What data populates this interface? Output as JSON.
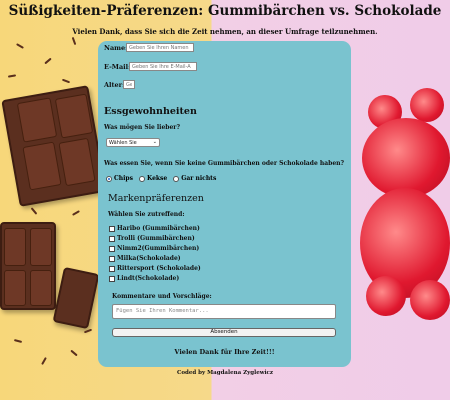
{
  "header": {
    "title": "Süßigkeiten-Präferenzen: Gummibärchen vs. Schokolade",
    "subtitle": "Vielen Dank, dass Sie sich die Zeit nehmen, an dieser Umfrage teilzunehmen."
  },
  "form": {
    "name_label": "Name:",
    "name_placeholder": "Geben Sie Ihren Namen",
    "email_label": "E-Mail:",
    "email_placeholder": "Geben Sie Ihre E-Mail-A",
    "age_label": "Alter:",
    "age_placeholder": "Ge",
    "eating_heading": "Essgewohnheiten",
    "prefer_question": "Was mögen Sie lieber?",
    "prefer_select": "Wählen Sie",
    "alt_question": "Was essen Sie, wenn Sie keine Gummibärchen oder Schokolade haben?",
    "alt_options": [
      "Chips",
      "Kekse",
      "Gar nichts"
    ],
    "brand_heading": "Markenpräferenzen",
    "brand_instruction": "Wählen Sie zutreffend:",
    "brands": [
      "Haribo (Gummibärchen)",
      "Trolli (Gummibärchen)",
      "Nimm2(Gummibärchen)",
      "Milka(Schokolade)",
      "Rittersport (Schokolade)",
      "Lindt(Schokolade)"
    ],
    "comments_label": "Kommentare und Vorschläge:",
    "comments_placeholder": "Fügen Sie Ihren Kommentar...",
    "submit_label": "Absenden",
    "thanks": "Vielen Dank für Ihre Zeit!!!"
  },
  "footer": {
    "text": "Coded by Magdalena Zyglewicz"
  },
  "colors": {
    "card": "#7ac3cf",
    "left_bg": "#f7d77a",
    "right_bg": "#f0cce8"
  }
}
